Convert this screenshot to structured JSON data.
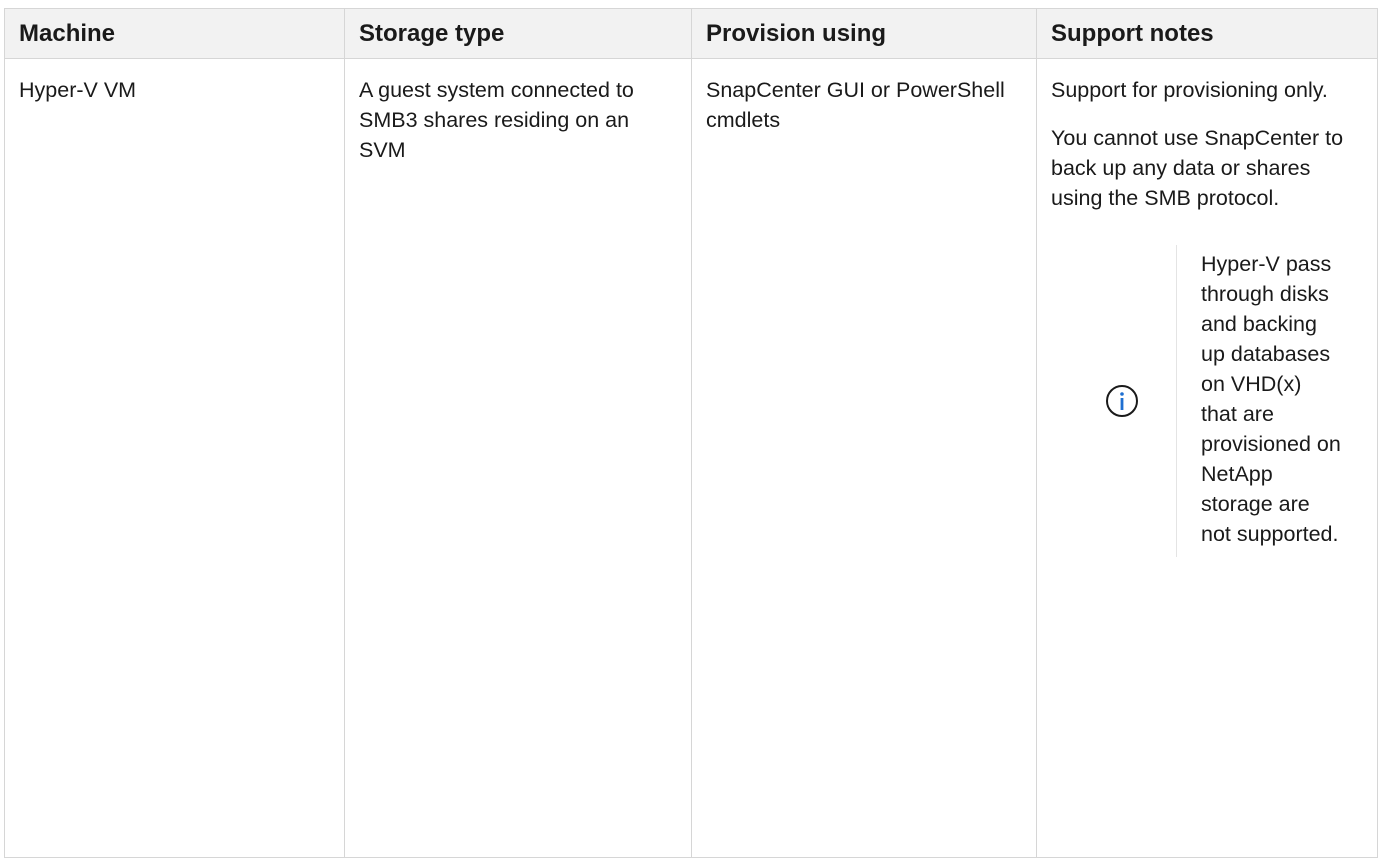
{
  "table": {
    "headers": [
      "Machine",
      "Storage type",
      "Provision using",
      "Support notes"
    ],
    "row": {
      "machine": "Hyper-V VM",
      "storage_type": "A guest system connected to SMB3 shares residing on an SVM",
      "provision_using": "SnapCenter GUI or PowerShell cmdlets",
      "support_notes": {
        "paragraphs": [
          "Support for provisioning only.",
          "You cannot use SnapCenter to back up any data or shares using the SMB protocol."
        ],
        "note": {
          "icon": "info-icon",
          "text": "Hyper-V pass through disks and backing up databases on VHD(x) that are provisioned on NetApp storage are not supported."
        }
      }
    }
  },
  "colors": {
    "header_background": "#f2f2f2",
    "border": "#d6d6d6",
    "text": "#1a1a1a",
    "icon": "#1a1a1a"
  }
}
